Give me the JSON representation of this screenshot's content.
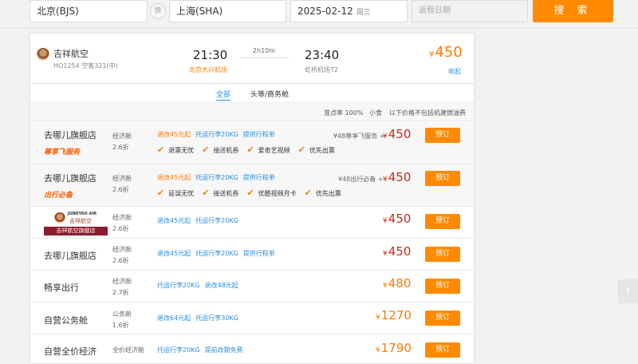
{
  "search": {
    "from": "北京(BJS)",
    "swap_label": "换",
    "to": "上海(SHA)",
    "date": "2025-02-12",
    "weekday": "周三",
    "return_placeholder": "返程日期",
    "search_label": "搜 索"
  },
  "flight": {
    "airline": "吉祥航空",
    "flight_no": "HO1254 空客321(中)",
    "dep_time": "21:30",
    "dep_airport": "北京大兴机场",
    "duration": "2h10m",
    "arr_time": "23:40",
    "arr_airport": "虹桥机场T2",
    "price_symbol": "¥",
    "price": "450",
    "collapse_label": "收起"
  },
  "cabin_tabs": [
    {
      "label": "全部",
      "active": true
    },
    {
      "label": "头等/商务舱",
      "active": false
    }
  ],
  "notes": {
    "ontime": "准点率 100%",
    "meal": "小食",
    "tax": "以下价格不包括机建燃油费"
  },
  "offers": [
    {
      "vendor": "去哪儿旗舰店",
      "tag": "尊享飞服务",
      "cabin": "经济舱",
      "discount": "2.6折",
      "rules": [
        {
          "text": "退改45元起",
          "color": "orange"
        },
        {
          "text": "托运行李20KG",
          "color": "blue"
        },
        {
          "text": "提供行程单",
          "color": "blue"
        }
      ],
      "perks": [
        "退票无忧",
        "接送机券",
        "爱奇艺视频",
        "优先出票"
      ],
      "service": "¥48尊享飞服务 +",
      "price": "450",
      "book_label": "预订"
    },
    {
      "vendor": "去哪儿旗舰店",
      "tag": "出行必备",
      "cabin": "经济舱",
      "discount": "2.6折",
      "rules": [
        {
          "text": "退改45元起",
          "color": "orange"
        },
        {
          "text": "托运行李20KG",
          "color": "blue"
        },
        {
          "text": "提供行程单",
          "color": "blue"
        }
      ],
      "perks": [
        "延误无忧",
        "接送机券",
        "优酷视频月卡",
        "优先出票"
      ],
      "service": "¥48出行必备 +",
      "price": "450",
      "book_label": "预订"
    },
    {
      "vendor_logo_en": "JUNEYAO AIR",
      "vendor_logo_cn": "吉祥航空",
      "vendor_logo_bar": "吉祥航空旗舰店",
      "cabin": "经济舱",
      "discount": "2.6折",
      "rules": [
        {
          "text": "退改45元起",
          "color": "blue"
        },
        {
          "text": "托运行李20KG",
          "color": "blue"
        }
      ],
      "price": "450",
      "book_label": "预订"
    },
    {
      "vendor": "去哪儿旗舰店",
      "cabin": "经济舱",
      "discount": "2.6折",
      "rules": [
        {
          "text": "退改45元起",
          "color": "blue"
        },
        {
          "text": "托运行李20KG",
          "color": "blue"
        },
        {
          "text": "提供行程单",
          "color": "blue"
        }
      ],
      "price": "450",
      "book_label": "预订"
    },
    {
      "vendor": "畅享出行",
      "cabin": "经济舱",
      "discount": "2.7折",
      "rules": [
        {
          "text": "托运行李20KG",
          "color": "blue"
        },
        {
          "text": "退改48元起",
          "color": "blue"
        }
      ],
      "price": "480",
      "book_label": "预订"
    },
    {
      "vendor": "自营公务舱",
      "cabin": "公务舱",
      "discount": "1.6折",
      "rules": [
        {
          "text": "退改64元起",
          "color": "blue"
        },
        {
          "text": "托运行李30KG",
          "color": "blue"
        }
      ],
      "price": "1270",
      "book_label": "预订"
    },
    {
      "vendor": "自营全价经济",
      "cabin": "全价经济舱",
      "rules": [
        {
          "text": "托运行李20KG",
          "color": "blue"
        },
        {
          "text": "提前改期免费",
          "color": "blue"
        }
      ],
      "price": "1790",
      "book_label": "预订"
    }
  ],
  "yen": "¥",
  "back_to_top_icon": "arrow-up-icon"
}
